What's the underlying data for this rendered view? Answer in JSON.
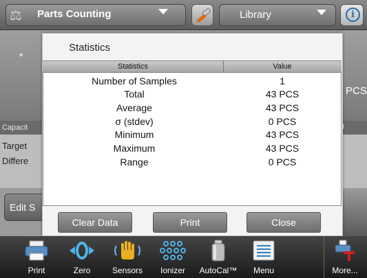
{
  "header": {
    "app_title": "Parts Counting",
    "library_label": "Library",
    "info_label": "i"
  },
  "background": {
    "star": "*",
    "unit": "PCS",
    "capacity_label": "Capacit",
    "capacity_right": ")",
    "target_label": "Target",
    "difference_label": "Differe",
    "edit_label": "Edit S"
  },
  "dialog": {
    "title": "Statistics",
    "columns": [
      "Statistics",
      "Value"
    ],
    "rows": [
      {
        "name": "Number of Samples",
        "value": "1"
      },
      {
        "name": "Total",
        "value": "43 PCS"
      },
      {
        "name": "Average",
        "value": "43 PCS"
      },
      {
        "name": "σ (stdev)",
        "value": "0 PCS"
      },
      {
        "name": "Minimum",
        "value": "43 PCS"
      },
      {
        "name": "Maximum",
        "value": "43 PCS"
      },
      {
        "name": "Range",
        "value": "0 PCS"
      }
    ],
    "buttons": {
      "clear": "Clear Data",
      "print": "Print",
      "close": "Close"
    }
  },
  "bottombar": {
    "items": [
      {
        "label": "Print",
        "icon": "printer-icon"
      },
      {
        "label": "Zero",
        "icon": "zero-icon"
      },
      {
        "label": "Sensors",
        "icon": "hand-sensor-icon"
      },
      {
        "label": "Ionizer",
        "icon": "ionizer-icon"
      },
      {
        "label": "AutoCal™",
        "icon": "calibration-weight-icon"
      },
      {
        "label": "Menu",
        "icon": "menu-list-icon"
      },
      {
        "label": "More...",
        "icon": "more-icon"
      }
    ]
  }
}
